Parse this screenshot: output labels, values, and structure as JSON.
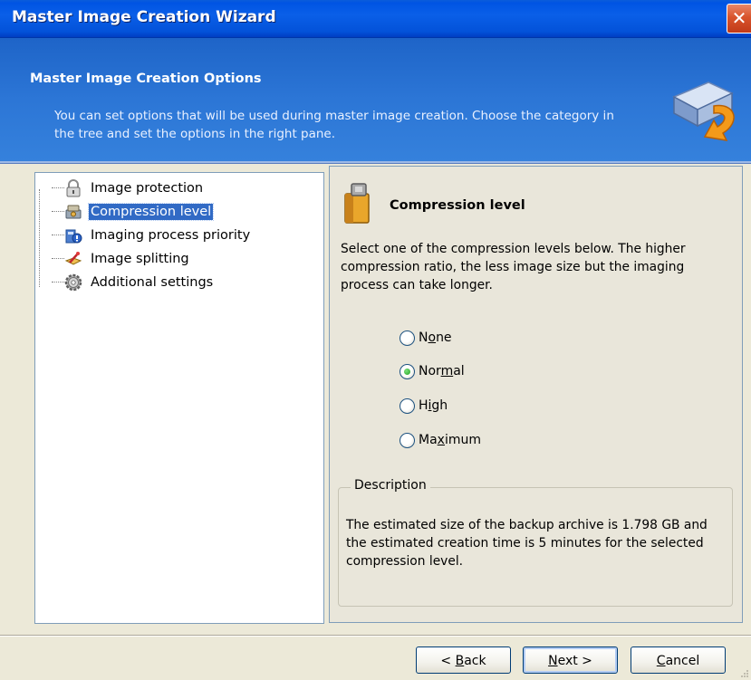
{
  "window": {
    "title": "Master Image Creation Wizard",
    "close_label": "✕"
  },
  "banner": {
    "heading": "Master Image Creation Options",
    "description": "You can set options that will be used during master image creation. Choose the category in the tree and set the options in the right pane."
  },
  "tree": {
    "items": [
      {
        "label": "Image protection",
        "icon": "lock-icon"
      },
      {
        "label": "Compression level",
        "icon": "compression-icon",
        "selected": true
      },
      {
        "label": "Imaging process priority",
        "icon": "priority-icon"
      },
      {
        "label": "Image splitting",
        "icon": "splitting-icon"
      },
      {
        "label": "Additional settings",
        "icon": "settings-gear-icon"
      }
    ]
  },
  "options": {
    "title": "Compression level",
    "description": "Select one of the compression levels below. The higher compression ratio, the less image size but the imaging process can take longer.",
    "radios": [
      {
        "pre": "N",
        "accel": "o",
        "post": "ne",
        "checked": false
      },
      {
        "pre": "Nor",
        "accel": "m",
        "post": "al",
        "checked": true
      },
      {
        "pre": "H",
        "accel": "i",
        "post": "gh",
        "checked": false
      },
      {
        "pre": "Ma",
        "accel": "x",
        "post": "imum",
        "checked": false
      }
    ],
    "group_title": "Description",
    "group_text": "The estimated size of the backup archive is 1.798 GB and the estimated creation time is 5 minutes for the selected compression level."
  },
  "buttons": {
    "back": {
      "pre": "< ",
      "accel": "B",
      "post": "ack"
    },
    "next": {
      "pre": "",
      "accel": "N",
      "post": "ext >"
    },
    "cancel": {
      "pre": "",
      "accel": "C",
      "post": "ancel"
    }
  }
}
